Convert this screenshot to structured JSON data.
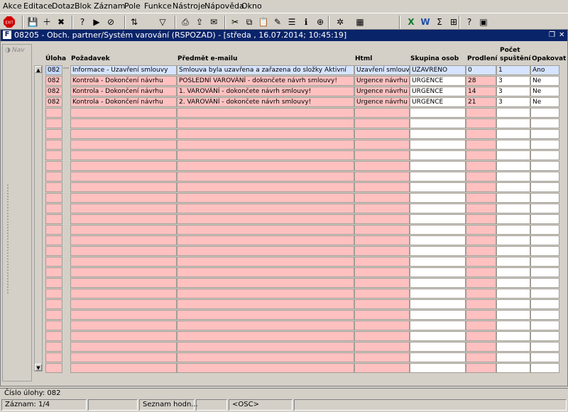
{
  "menu": [
    "Akce",
    "Editace",
    "Dotaz",
    "Blok",
    "Záznam",
    "Pole",
    "Funkce",
    "Nástroje",
    "Nápověda",
    "Okno"
  ],
  "toolbar": {
    "exit_label": "EXIT",
    "icons": [
      "save-icon",
      "insert-record-icon",
      "delete-record-icon",
      "enter-query-icon",
      "execute-query-icon",
      "cancel-query-icon",
      "sort-icon",
      "filter-icon",
      "print-icon",
      "export-icon",
      "mail-icon",
      "cut-icon",
      "copy-icon",
      "paste-icon",
      "edit-icon",
      "list-icon",
      "info-icon",
      "navigate-icon",
      "settings-icon",
      "calendar-icon",
      "excel-icon",
      "word-icon",
      "sigma-icon",
      "calculator-icon",
      "help-icon",
      "window-icon"
    ]
  },
  "window": {
    "title": "08205 - Obch. partner/Systém varování (RSPOZAD) - [středa , 16.07.2014; 10:45:19]",
    "icon": "F",
    "nav_label": "Nav"
  },
  "columns": {
    "uloha": "Úloha",
    "pozadavek": "Požadavek",
    "predmet": "Předmět e-mailu",
    "html": "Html",
    "skupina": "Skupina osob",
    "prodleni": "Prodlení",
    "pocet1": "Počet",
    "pocet2": "spuštění",
    "opakovat": "Opakovat"
  },
  "rows": [
    {
      "uloha": "082",
      "pozadavek": "Informace - Uzavření smlouvy",
      "predmet": "Smlouva byla uzavřena a zařazena do složky Aktivní",
      "html": "Uzavření smlouvy",
      "skupina": "UZAVRENO",
      "prodleni": "0",
      "pocet": "1",
      "opakovat": "Ano"
    },
    {
      "uloha": "082",
      "pozadavek": "Kontrola - Dokončení návrhu",
      "predmet": "POSLEDNÍ VAROVÁNÍ - dokončete návrh smlouvy!",
      "html": "Urgence návrhu",
      "skupina": "URGENCE",
      "prodleni": "28",
      "pocet": "3",
      "opakovat": "Ne"
    },
    {
      "uloha": "082",
      "pozadavek": "Kontrola - Dokončení návrhu",
      "predmet": "1. VAROVÁNÍ - dokončete návrh smlouvy!",
      "html": "Urgence návrhu",
      "skupina": "URGENCE",
      "prodleni": "14",
      "pocet": "3",
      "opakovat": "Ne"
    },
    {
      "uloha": "082",
      "pozadavek": "Kontrola - Dokončení návrhu",
      "predmet": "2. VAROVÁNÍ - dokončete návrh smlouvy!",
      "html": "Urgence návrhu",
      "skupina": "URGENCE",
      "prodleni": "21",
      "pocet": "3",
      "opakovat": "Ne"
    }
  ],
  "empty_rows": 25,
  "message": "Číslo úlohy: 082",
  "status": {
    "record": "Záznam: 1/4",
    "list": "Seznam hodn...",
    "mode": "<OSC>"
  },
  "colors": {
    "pink": "#ffc0c0",
    "white": "#ffffff",
    "current": "#c2d6ff",
    "title": "#0a246a"
  }
}
